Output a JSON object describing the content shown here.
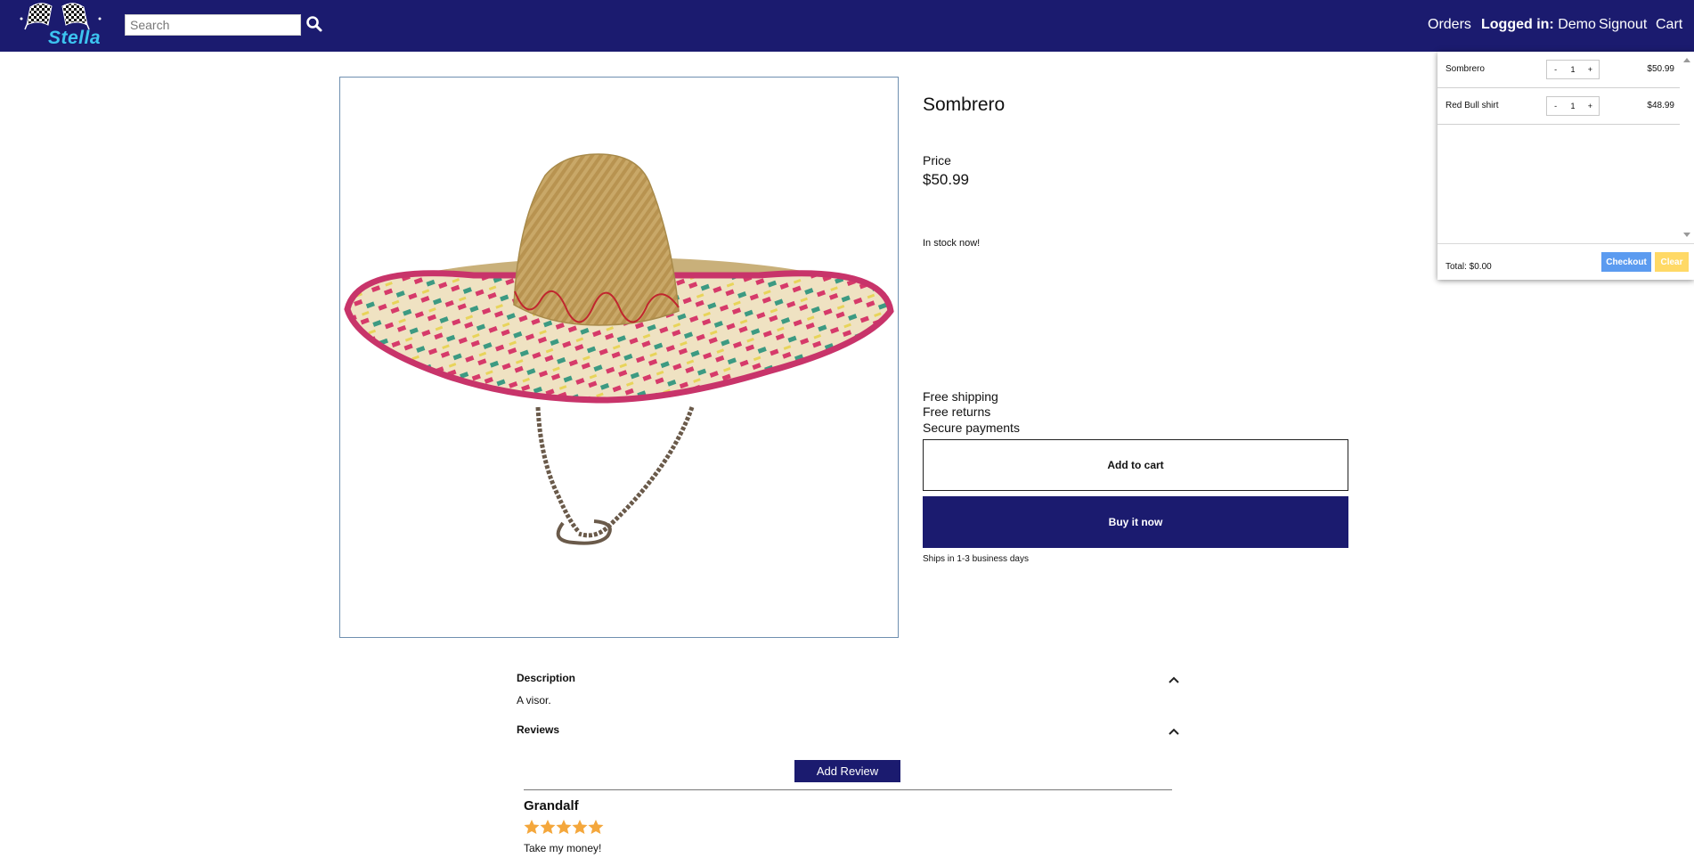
{
  "header": {
    "brand": "Stella",
    "search_placeholder": "Search",
    "nav": {
      "orders": "Orders",
      "logged_in_label": "Logged in:",
      "user": "Demo",
      "signout": "Signout",
      "cart": "Cart"
    }
  },
  "product": {
    "title": "Sombrero",
    "price_label": "Price",
    "price": "$50.99",
    "stock": "In stock now!",
    "perks": [
      "Free shipping",
      "Free returns",
      "Secure payments"
    ],
    "add_to_cart": "Add to cart",
    "buy_now": "Buy it now",
    "ships": "Ships in 1-3 business days"
  },
  "details": {
    "description_label": "Description",
    "description": "A visor.",
    "reviews_label": "Reviews",
    "add_review": "Add Review",
    "reviews": [
      {
        "author": "Grandalf",
        "rating": 5,
        "text": "Take my money!"
      }
    ]
  },
  "cart": {
    "items": [
      {
        "name": "Sombrero",
        "qty": "1",
        "price": "$50.99",
        "minus": "-",
        "plus": "+"
      },
      {
        "name": "Red Bull shirt",
        "qty": "1",
        "price": "$48.99",
        "minus": "-",
        "plus": "+"
      }
    ],
    "total": "Total: $0.00",
    "checkout": "Checkout",
    "clear": "Clear"
  },
  "colors": {
    "header_bg": "#1b1b6f",
    "brand_text": "#3cc4f0",
    "star": "#f4a73c",
    "checkout": "#5b9bf0",
    "clear": "#ffd966"
  },
  "icons": {
    "search": "search-icon",
    "chevron": "chevron-up-icon",
    "star": "star-icon",
    "logo": "checkered-flags-logo"
  }
}
